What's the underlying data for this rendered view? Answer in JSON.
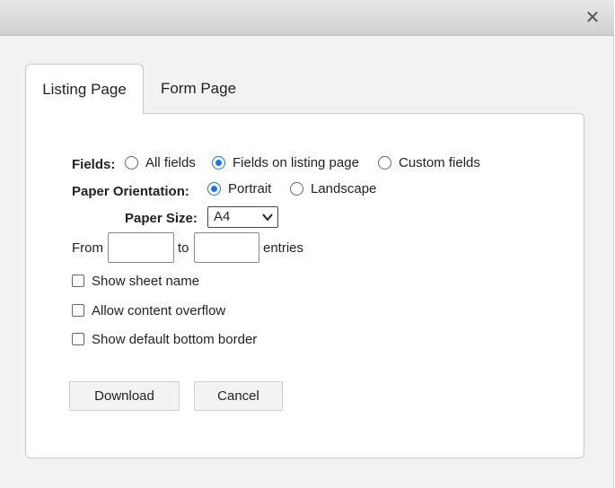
{
  "dialog": {
    "close_icon": "close-icon"
  },
  "tabs": [
    {
      "label": "Listing Page",
      "active": true
    },
    {
      "label": "Form Page",
      "active": false
    }
  ],
  "form": {
    "fields_label": "Fields:",
    "fields_options": [
      {
        "label": "All fields",
        "selected": false
      },
      {
        "label": "Fields on listing page",
        "selected": true
      },
      {
        "label": "Custom fields",
        "selected": false
      }
    ],
    "orientation_label": "Paper Orientation:",
    "orientation_options": [
      {
        "label": "Portrait",
        "selected": true
      },
      {
        "label": "Landscape",
        "selected": false
      }
    ],
    "paper_size_label": "Paper Size:",
    "paper_size_value": "A4",
    "from_label": "From",
    "to_label": "to",
    "entries_label": "entries",
    "from_value": "",
    "to_value": "",
    "checkboxes": [
      {
        "label": "Show sheet name",
        "checked": false
      },
      {
        "label": "Allow content overflow",
        "checked": false
      },
      {
        "label": "Show default bottom border",
        "checked": false
      }
    ]
  },
  "buttons": {
    "download": "Download",
    "cancel": "Cancel"
  },
  "colors": {
    "accent": "#1a73e8",
    "titlebar": "#d6d6d6",
    "background": "#f2f2f2"
  }
}
